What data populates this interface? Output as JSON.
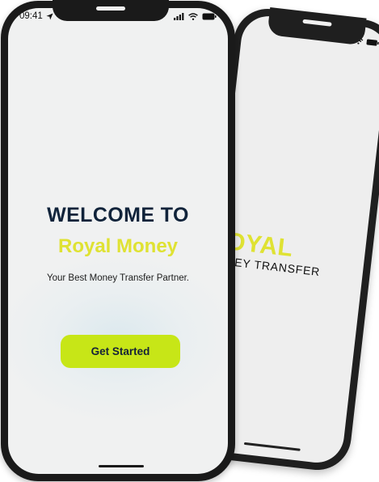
{
  "front_phone": {
    "status_bar": {
      "time": "09:41"
    },
    "welcome_title": "WELCOME TO",
    "brand_name": "Royal Money",
    "tagline": "Your Best Money Transfer Partner.",
    "cta_label": "Get Started"
  },
  "back_phone": {
    "logo_word": "ROYAL",
    "logo_sub": "MONEY TRANSFER"
  },
  "colors": {
    "brand_yellow": "#dfe233",
    "cta_green": "#c7e617",
    "title_navy": "#10233a",
    "screen_bg": "#f0f1f1",
    "frame": "#1a1a1a"
  },
  "icons": {
    "location": "location-arrow-icon",
    "signal": "signal-bars-icon",
    "wifi": "wifi-icon",
    "battery": "battery-icon"
  }
}
